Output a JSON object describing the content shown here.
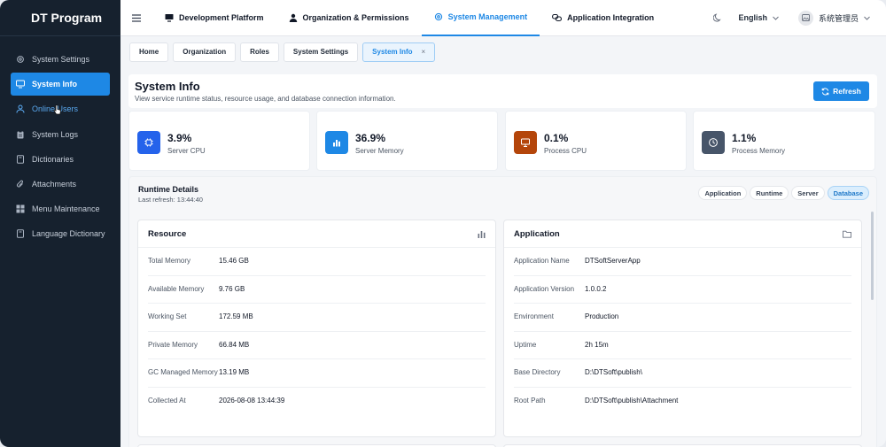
{
  "app": {
    "brand": "DT Program"
  },
  "sidebar": {
    "items": [
      {
        "label": "System Settings",
        "icon": "gear-icon"
      },
      {
        "label": "System Info",
        "icon": "monitor-icon"
      },
      {
        "label": "Online Users",
        "icon": "user-icon"
      },
      {
        "label": "System Logs",
        "icon": "clipboard-icon"
      },
      {
        "label": "Dictionaries",
        "icon": "book-icon"
      },
      {
        "label": "Attachments",
        "icon": "paperclip-icon"
      },
      {
        "label": "Menu Maintenance",
        "icon": "grid-icon"
      },
      {
        "label": "Language Dictionary",
        "icon": "book-icon"
      }
    ]
  },
  "header": {
    "nav": [
      {
        "label": "Development Platform",
        "icon": "monitor-icon"
      },
      {
        "label": "Organization & Permissions",
        "icon": "user-icon"
      },
      {
        "label": "System Management",
        "icon": "gear-icon"
      },
      {
        "label": "Application Integration",
        "icon": "link-icon"
      }
    ],
    "language": "English",
    "user": "系统管理员"
  },
  "tabs": [
    {
      "label": "Home"
    },
    {
      "label": "Organization"
    },
    {
      "label": "Roles"
    },
    {
      "label": "System Settings"
    },
    {
      "label": "System Info",
      "close": "×"
    }
  ],
  "page": {
    "title": "System Info",
    "subtitle": "View service runtime status, resource usage, and database connection information.",
    "refresh": "Refresh"
  },
  "stats": [
    {
      "value": "3.9%",
      "label": "Server CPU",
      "color": "#2563eb"
    },
    {
      "value": "36.9%",
      "label": "Server Memory",
      "color": "#1e88e5"
    },
    {
      "value": "0.1%",
      "label": "Process CPU",
      "color": "#b4450a"
    },
    {
      "value": "1.1%",
      "label": "Process Memory",
      "color": "#475569"
    }
  ],
  "runtime": {
    "title": "Runtime Details",
    "last_refresh": "Last refresh: 13:44:40",
    "tabs": [
      "Application",
      "Runtime",
      "Server",
      "Database"
    ]
  },
  "resource": {
    "title": "Resource",
    "rows": [
      {
        "k": "Total Memory",
        "v": "15.46 GB"
      },
      {
        "k": "Available Memory",
        "v": "9.76 GB"
      },
      {
        "k": "Working Set",
        "v": "172.59 MB"
      },
      {
        "k": "Private Memory",
        "v": "66.84 MB"
      },
      {
        "k": "GC Managed Memory",
        "v": "13.19 MB"
      },
      {
        "k": "Collected At",
        "v": "2026-08-08 13:44:39"
      }
    ]
  },
  "application": {
    "title": "Application",
    "rows": [
      {
        "k": "Application Name",
        "v": "DTSoftServerApp"
      },
      {
        "k": "Application Version",
        "v": "1.0.0.2"
      },
      {
        "k": "Environment",
        "v": "Production"
      },
      {
        "k": "Uptime",
        "v": "2h 15m"
      },
      {
        "k": "Base Directory",
        "v": "D:\\DTSoft\\publish\\"
      },
      {
        "k": "Root Path",
        "v": "D:\\DTSoft\\publish\\Attachment"
      }
    ]
  }
}
